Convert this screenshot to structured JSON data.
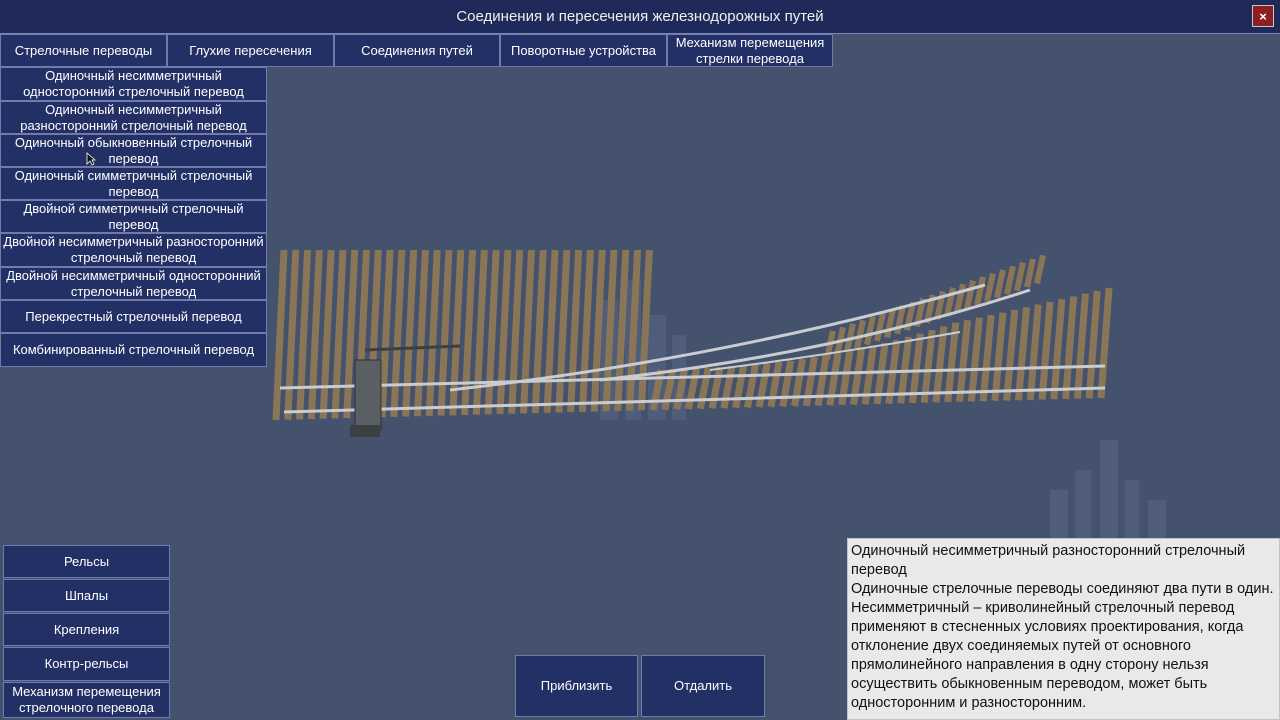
{
  "window": {
    "title": "Соединения и пересечения железнодорожных путей",
    "close_label": "×"
  },
  "tabs": [
    {
      "label": "Стрелочные переводы"
    },
    {
      "label": "Глухие пересечения"
    },
    {
      "label": "Соединения путей"
    },
    {
      "label": "Поворотные устройства"
    },
    {
      "label": "Механизм перемещения стрелки перевода"
    }
  ],
  "switch_types": [
    {
      "label": "Одиночный несимметричный односторонний стрелочный перевод"
    },
    {
      "label": "Одиночный несимметричный разносторонний стрелочный перевод"
    },
    {
      "label": "Одиночный обыкновенный стрелочный перевод"
    },
    {
      "label": "Одиночный симметричный стрелочный перевод"
    },
    {
      "label": "Двойной симметричный стрелочный перевод"
    },
    {
      "label": "Двойной несимметричный разносторонний стрелочный перевод"
    },
    {
      "label": "Двойной несимметричный односторонний стрелочный перевод"
    },
    {
      "label": "Перекрестный стрелочный перевод"
    },
    {
      "label": "Комбинированный стрелочный перевод"
    }
  ],
  "components": [
    {
      "label": "Рельсы"
    },
    {
      "label": "Шпалы"
    },
    {
      "label": "Крепления"
    },
    {
      "label": "Контр-рельсы"
    },
    {
      "label": "Механизм перемещения стрелочного перевода"
    }
  ],
  "zoom": {
    "in_label": "Приблизить",
    "out_label": "Отдалить"
  },
  "description": {
    "title": "Одиночный несимметричный разносторонний стрелочный перевод",
    "text": "Одиночные стрелочные переводы соединяют два пути в один. Несимметричный – криволинейный стрелочный перевод применяют в стесненных условиях проектирования, когда отклонение двух соединяемых путей от основного прямолинейного направления в одну сторону нельзя осуществить обыкновенным переводом, может быть односторонним и разносторонним."
  },
  "colors": {
    "background": "#44526d",
    "button": "#223065",
    "button_border": "#6f7cab",
    "panel": "#e9e9ea",
    "close": "#8e1e20",
    "sleeper": "#8a7656",
    "rail": "#c9ccd0"
  }
}
